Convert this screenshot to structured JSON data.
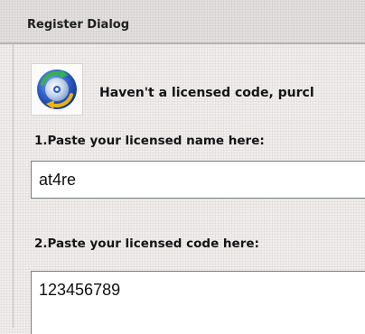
{
  "window": {
    "title": "Register Dialog"
  },
  "icon": {
    "name": "cd-refresh-icon"
  },
  "message": {
    "text": "Haven't a licensed code, purcl"
  },
  "name_field": {
    "label": "1.Paste your licensed name here:",
    "value": "at4re"
  },
  "code_field": {
    "label": "2.Paste your licensed code here:",
    "value": "123456789"
  },
  "colors": {
    "background": "#f1eded",
    "titlebar": "#e3dfdf",
    "input_border": "#7e7e7e",
    "icon_blue": "#2f5fc8",
    "icon_gold": "#e8b21c",
    "icon_green": "#34b34a"
  }
}
